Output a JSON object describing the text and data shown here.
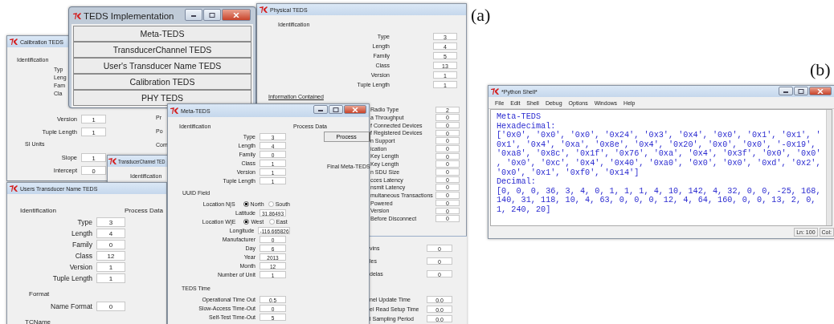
{
  "label_a": "(a)",
  "label_b": "(b)",
  "calibration_teds": {
    "title": "Calibration TEDS",
    "identification_heading": "Identification",
    "partial_labels": [
      "Typ",
      "Leng",
      "Fam",
      "Cla"
    ],
    "fields": [
      {
        "label": "Version",
        "value": "1"
      },
      {
        "label": "Tuple Length",
        "value": "1"
      }
    ],
    "si_units_heading": "SI Units",
    "si_fields": [
      {
        "label": "Slope",
        "value": "1"
      },
      {
        "label": "Intercept",
        "value": "0"
      }
    ],
    "column_2_labels": [
      "Pr",
      "Po",
      "Com"
    ]
  },
  "transducer_channel_teds": {
    "title": "TransducerChannel TED",
    "identification_heading": "Identification"
  },
  "users_transducer_name_teds": {
    "title": "Users Transducer Name TEDS",
    "identification_heading": "Identification",
    "process_data_heading": "Process Data",
    "fields": [
      {
        "label": "Type",
        "value": "3"
      },
      {
        "label": "Length",
        "value": "4"
      },
      {
        "label": "Family",
        "value": "0"
      },
      {
        "label": "Class",
        "value": "12"
      },
      {
        "label": "Version",
        "value": "1"
      },
      {
        "label": "Tuple Length",
        "value": "1"
      }
    ],
    "format_heading": "Format",
    "format_fields": [
      {
        "label": "Name Format",
        "value": "0"
      }
    ],
    "tcname_heading": "TCName"
  },
  "physical_teds": {
    "title": "Physical TEDS",
    "identification_heading": "Identification",
    "fields": [
      {
        "label": "Type",
        "value": "3"
      },
      {
        "label": "Length",
        "value": "4"
      },
      {
        "label": "Family",
        "value": "5"
      },
      {
        "label": "Class",
        "value": "13"
      },
      {
        "label": "Version",
        "value": "1"
      },
      {
        "label": "Tuple Length",
        "value": "1"
      }
    ],
    "information_heading": "Information Contained",
    "information_fields": [
      {
        "label": "Radio Type",
        "value": "2"
      },
      {
        "label": "a Throughput",
        "value": "0"
      },
      {
        "label": "f Connected Devices",
        "value": "0"
      },
      {
        "label": "f Registered Devices",
        "value": "0"
      },
      {
        "label": "n Support",
        "value": "0"
      },
      {
        "label": "ication",
        "value": "0"
      },
      {
        "label": "Key Length",
        "value": "0"
      },
      {
        "label": "Key Length",
        "value": "0"
      },
      {
        "label": "n SDU Size",
        "value": "0"
      },
      {
        "label": "cces Latency",
        "value": "0"
      },
      {
        "label": "nsmit Latency",
        "value": "0"
      },
      {
        "label": "multaneous Transactions",
        "value": "0"
      },
      {
        "label": "Powered",
        "value": "0"
      },
      {
        "label": "Version",
        "value": "0"
      },
      {
        "label": "Before Disconnect",
        "value": "0"
      }
    ]
  },
  "lower_window": {
    "fields": [
      {
        "label": "vins",
        "value": "0"
      },
      {
        "label": "les",
        "value": "0"
      },
      {
        "label": "delas",
        "value": "0"
      }
    ],
    "time_fields": [
      {
        "label": "nel Update Time",
        "value": "0.0"
      },
      {
        "label": "el Read Setup Time",
        "value": "0.0"
      },
      {
        "label": "l Sampling Period",
        "value": "0.0"
      }
    ]
  },
  "teds_implementation": {
    "title": "TEDS Implementation",
    "buttons": [
      "Meta-TEDS",
      "TransducerChannel TEDS",
      "User's Transducer Name TEDS",
      "Calibration TEDS",
      "PHY TEDS"
    ]
  },
  "meta_teds": {
    "title": "Meta-TEDS",
    "identification_heading": "Identification",
    "fields": [
      {
        "label": "Type",
        "value": "3"
      },
      {
        "label": "Length",
        "value": "4"
      },
      {
        "label": "Family",
        "value": "0"
      },
      {
        "label": "Class",
        "value": "1"
      },
      {
        "label": "Version",
        "value": "1"
      },
      {
        "label": "Tuple Length",
        "value": "1"
      }
    ],
    "uuid_heading": "UUID Field",
    "uuid_rows": [
      {
        "kind": "radio",
        "label": "Location N|S",
        "options": [
          {
            "label": "North",
            "selected": true
          },
          {
            "label": "South",
            "selected": false
          }
        ]
      },
      {
        "kind": "field",
        "label": "Latitude",
        "value": "31.86493"
      },
      {
        "kind": "radio",
        "label": "Location W|E",
        "options": [
          {
            "label": "West",
            "selected": true
          },
          {
            "label": "East",
            "selected": false
          }
        ]
      },
      {
        "kind": "field",
        "label": "Longitude",
        "value": "-116.665826"
      },
      {
        "kind": "field",
        "label": "Manufacturer",
        "value": "0"
      },
      {
        "kind": "field",
        "label": "Day",
        "value": "6"
      },
      {
        "kind": "field",
        "label": "Year",
        "value": "2013"
      },
      {
        "kind": "field",
        "label": "Month",
        "value": "12"
      },
      {
        "kind": "field",
        "label": "Number of Unit",
        "value": "1"
      }
    ],
    "time_heading": "TEDS Time",
    "time_fields": [
      {
        "label": "Operational Time Out",
        "value": "0.5"
      },
      {
        "label": "Slow-Access Time-Out",
        "value": "0"
      },
      {
        "label": "Self-Test Time-Out",
        "value": "5"
      }
    ],
    "process_data_heading": "Process Data",
    "process_button": "Process",
    "final_label": "Final Meta-TEDS"
  },
  "python_shell": {
    "title": "*Python Shell*",
    "menu": [
      "File",
      "Edit",
      "Shell",
      "Debug",
      "Options",
      "Windows",
      "Help"
    ],
    "lines": [
      "Meta-TEDS",
      "Hexadecimal:",
      "['0x0', '0x0', '0x0', '0x24', '0x3', '0x4', '0x0', '0x1', '0x1', '",
      "0x1', '0x4', '0xa', '0x8e', '0x4', '0x20', '0x0', '0x0', '-0x19',",
      "'0xa8', '0x8c', '0x1f', '0x76', '0xa', '0x4', '0x3f', '0x0', '0x0'",
      ", '0x0', '0xc', '0x4', '0x40', '0xa0', '0x0', '0x0', '0xd', '0x2',",
      "'0x0', '0x1', '0xf0', '0x14']",
      "Decimal:",
      "[0, 0, 0, 36, 3, 4, 0, 1, 1, 1, 4, 10, 142, 4, 32, 0, 0, -25, 168,",
      "140, 31, 118, 10, 4, 63, 0, 0, 0, 12, 4, 64, 160, 0, 0, 13, 2, 0,",
      "1, 240, 20]"
    ],
    "status_line": "Ln: 100",
    "status_col": "Col:"
  }
}
